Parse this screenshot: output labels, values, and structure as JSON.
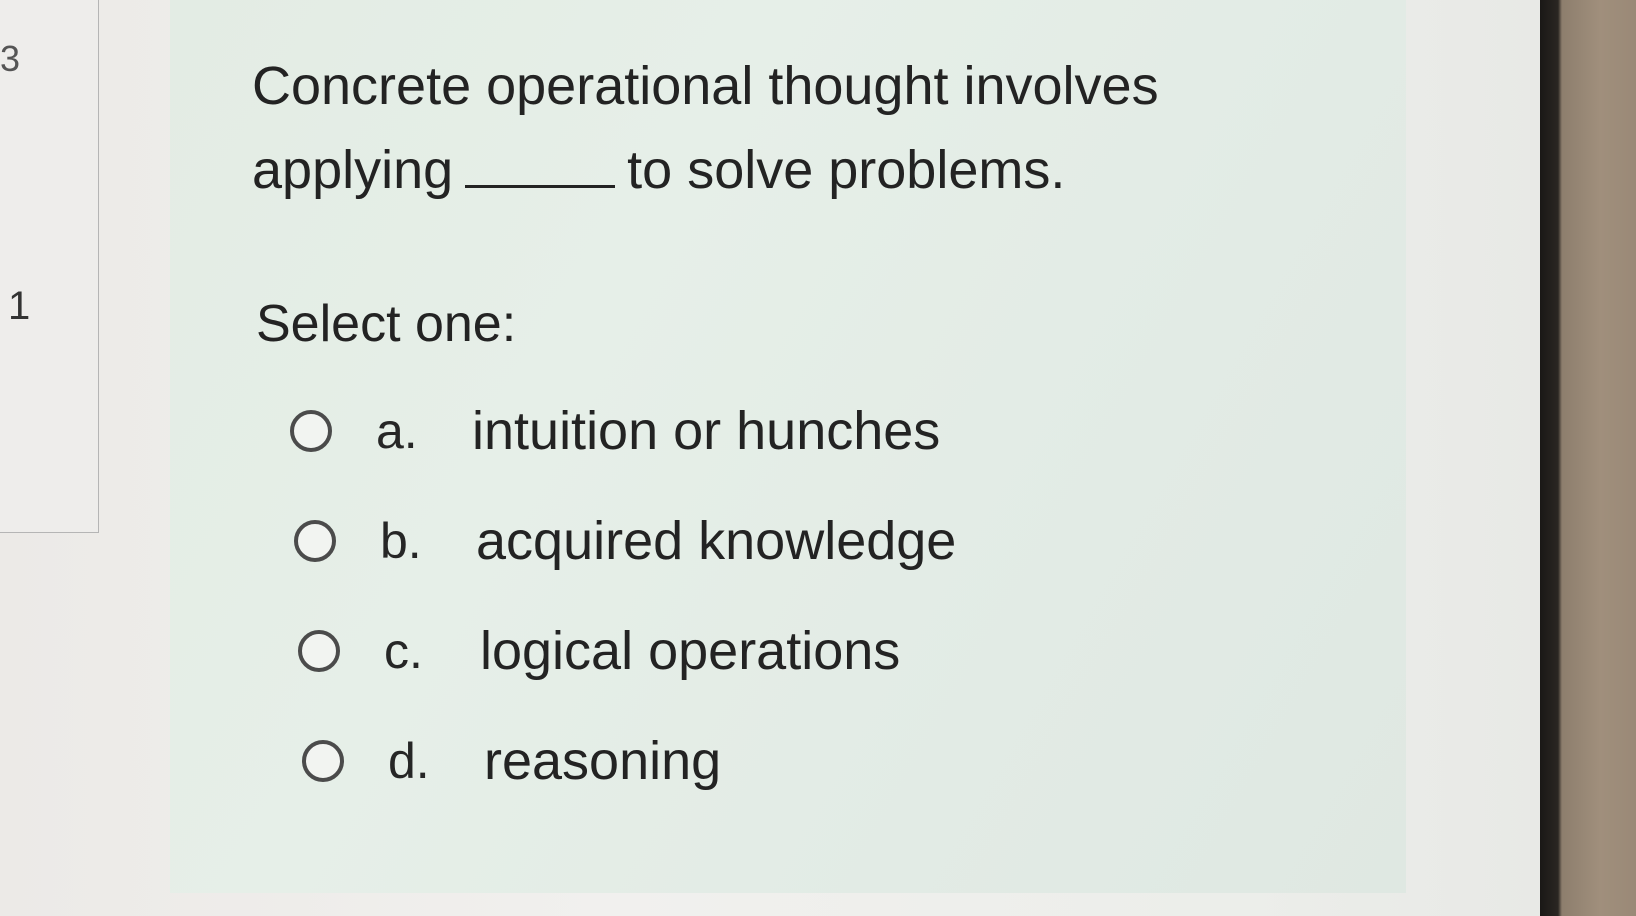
{
  "sidebar": {
    "question_number": "1",
    "edge_mark": "3"
  },
  "question": {
    "text_before_blank": "Concrete operational thought involves applying",
    "text_after_blank": "to solve problems.",
    "prompt": "Select one:",
    "options": [
      {
        "letter": "a.",
        "text": "intuition or hunches",
        "selected": false
      },
      {
        "letter": "b.",
        "text": "acquired knowledge",
        "selected": false
      },
      {
        "letter": "c.",
        "text": "logical operations",
        "selected": false
      },
      {
        "letter": "d.",
        "text": "reasoning",
        "selected": false
      }
    ]
  },
  "colors": {
    "panel_background": "#e3ece4",
    "text": "#232323",
    "radio_border": "#4b4b4b"
  }
}
